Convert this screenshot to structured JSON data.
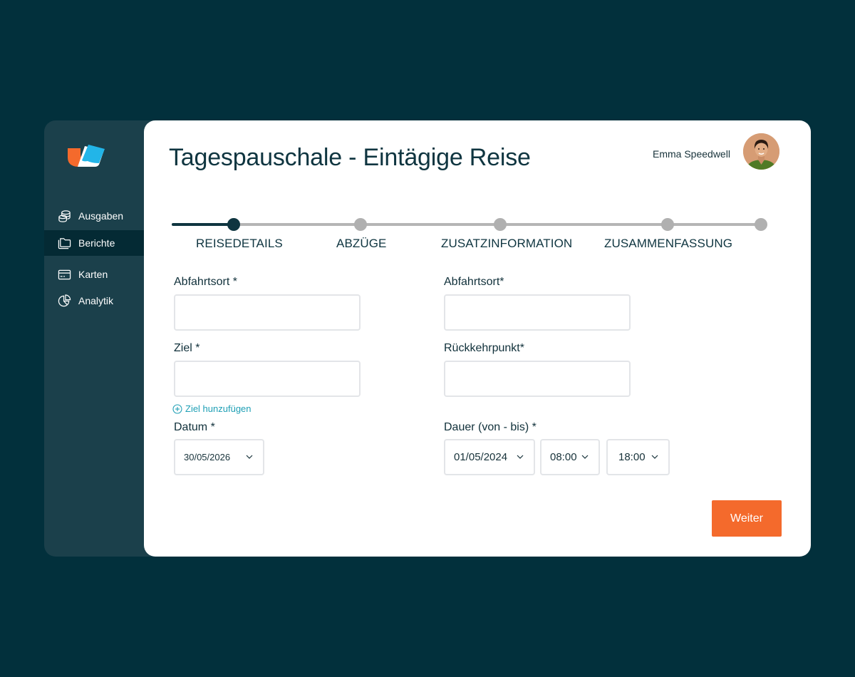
{
  "sidebar": {
    "items": [
      {
        "label": "Ausgaben",
        "icon": "coins-icon"
      },
      {
        "label": "Berichte",
        "icon": "folder-icon",
        "active": true
      },
      {
        "label": "Karten",
        "icon": "credit-card-icon"
      },
      {
        "label": "Analytik",
        "icon": "pie-chart-icon"
      }
    ]
  },
  "header": {
    "title": "Tagespauschale - Eintägige Reise",
    "user_name": "Emma Speedwell"
  },
  "stepper": {
    "steps": [
      "REISEDETAILS",
      "ABZÜGE",
      "ZUSATZINFORMATION",
      "ZUSAMMENFASSUNG"
    ],
    "current_index": 0
  },
  "form": {
    "departure_left": {
      "label": "Abfahrtsort *",
      "value": ""
    },
    "destination": {
      "label": "Ziel *",
      "value": ""
    },
    "add_destination": "Ziel hunzufügen",
    "date": {
      "label": "Datum *",
      "value": "30/05/2026"
    },
    "departure_right": {
      "label": "Abfahrtsort*",
      "value": ""
    },
    "return_point": {
      "label": "Rückkehrpunkt*",
      "value": ""
    },
    "duration": {
      "label": "Dauer (von - bis) *",
      "date": "01/05/2024",
      "from": "08:00",
      "to": "18:00"
    }
  },
  "actions": {
    "next_label": "Weiter"
  },
  "colors": {
    "background": "#02303c",
    "sidebar": "#1b404b",
    "sidebar_active": "#042a34",
    "primary_text": "#0f3540",
    "accent": "#f46a2c",
    "link": "#1e9fb5"
  }
}
